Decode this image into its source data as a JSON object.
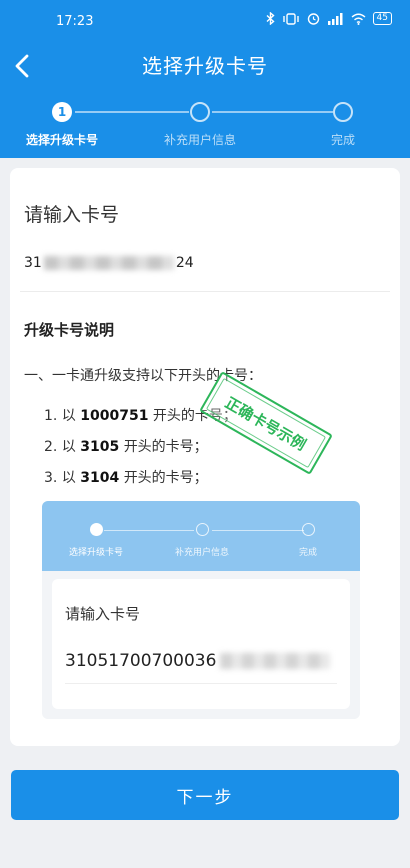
{
  "status_bar": {
    "time": "17:23",
    "battery": "45",
    "icons": [
      "bluetooth-icon",
      "vibrate-icon",
      "alarm-icon",
      "signal-icon",
      "wifi-icon",
      "battery-icon"
    ]
  },
  "nav": {
    "back_icon": "chevron-left-icon",
    "title": "选择升级卡号"
  },
  "steps": [
    {
      "number": "1",
      "label": "选择升级卡号",
      "state": "active"
    },
    {
      "number": "",
      "label": "补充用户信息",
      "state": "pending"
    },
    {
      "number": "",
      "label": "完成",
      "state": "pending"
    }
  ],
  "form": {
    "input_label": "请输入卡号",
    "card_prefix": "31",
    "card_suffix": "24"
  },
  "rules": {
    "title": "升级卡号说明",
    "intro": "一、一卡通升级支持以下开头的卡号：",
    "items": [
      {
        "index": "1. 以",
        "prefix": "1000751",
        "suffix": "开头的卡号；"
      },
      {
        "index": "2. 以",
        "prefix": "3105",
        "suffix": "开头的卡号；"
      },
      {
        "index": "3. 以",
        "prefix": "3104",
        "suffix": "开头的卡号；"
      }
    ]
  },
  "example": {
    "steps": [
      {
        "number": "",
        "label": "选择升级卡号",
        "state": "active"
      },
      {
        "number": "",
        "label": "补充用户信息",
        "state": "pending"
      },
      {
        "number": "",
        "label": "完成",
        "state": "pending"
      }
    ],
    "input_label": "请输入卡号",
    "card_number": "31051700700036",
    "stamp_text": "正确卡号示例"
  },
  "next_button": "下一步",
  "colors": {
    "primary": "#1a8fe8",
    "stamp": "#2db65a"
  }
}
